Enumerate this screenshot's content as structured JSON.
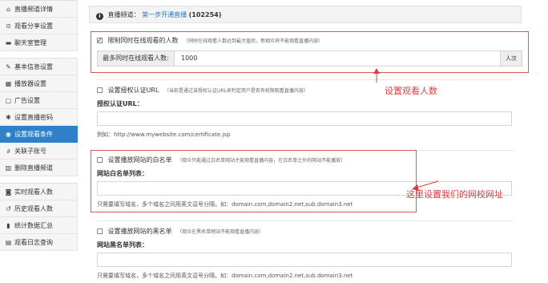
{
  "sidebar": {
    "group1": [
      {
        "label": "直播频道详情",
        "icon": "home-icon",
        "glyph": "⌂"
      },
      {
        "label": "观看分享设置",
        "icon": "share-icon",
        "glyph": "⊙"
      },
      {
        "label": "聊天室管理",
        "icon": "chat-icon",
        "glyph": "▬"
      }
    ],
    "group2": [
      {
        "label": "基本信息设置",
        "icon": "pencil-icon",
        "glyph": "✎"
      },
      {
        "label": "播放器设置",
        "icon": "player-icon",
        "glyph": "▦"
      },
      {
        "label": "广告设置",
        "icon": "ad-icon",
        "glyph": "▢"
      },
      {
        "label": "设置直播密码",
        "icon": "gear-icon",
        "glyph": "✱"
      },
      {
        "label": "设置观看条件",
        "icon": "eye-icon",
        "glyph": "◉",
        "active": true
      },
      {
        "label": "关联子账号",
        "icon": "link-icon",
        "glyph": "∂"
      },
      {
        "label": "删除直播频道",
        "icon": "trash-icon",
        "glyph": "▥"
      }
    ],
    "group3": [
      {
        "label": "实时观看人数",
        "icon": "realtime-icon",
        "glyph": "◙"
      },
      {
        "label": "历史观看人数",
        "icon": "history-icon",
        "glyph": "↺"
      },
      {
        "label": "统计数据汇总",
        "icon": "stats-icon",
        "glyph": "▮"
      },
      {
        "label": "观看日志查询",
        "icon": "log-icon",
        "glyph": "▤"
      }
    ]
  },
  "header": {
    "prefix": "直播频道：",
    "link": "第一步开通直播",
    "count": "(102254)"
  },
  "limit": {
    "label": "限制同时在线观看的人数",
    "hint": "（同时在线观看人数达到最大值后，新观众将不能观看直播内容）",
    "checked": true,
    "addon_left": "最多同时在线观看人数:",
    "value": "1000",
    "addon_right": "人次"
  },
  "auth": {
    "label": "设置授权认证URL",
    "hint": "（当前是通过该授权认证URL来判定用户是否有权限观看直播内容）",
    "checked": false,
    "field_label": "授权认证URL：",
    "value": "",
    "example": "例如：http://www.mywebsite.com/certificate.jsp"
  },
  "whitelist": {
    "label": "设置播放网站的白名单",
    "hint": "（观众只能通过白名单网站才能观看直播内容，在白名单之外的网站不能播放）",
    "checked": false,
    "field_label": "网站白名单列表：",
    "value": "",
    "help": "只需要填写域名，多个域名之间用英文逗号分隔，如：domain.com,domain2.net,sub.domain3.net"
  },
  "blacklist": {
    "label": "设置播放网站的黑名单",
    "hint": "（观众在黑名单网站不能观看直播内容）",
    "checked": false,
    "field_label": "网站黑名单列表：",
    "value": "",
    "help": "只需要填写域名，多个域名之间用英文逗号分隔，如：domain.com,domain2.net,sub.domain3.net"
  },
  "annotations": {
    "viewers": "设置观看人数",
    "whitelist": "这里设置我们的网校网址",
    "color": "#e03c3c"
  }
}
